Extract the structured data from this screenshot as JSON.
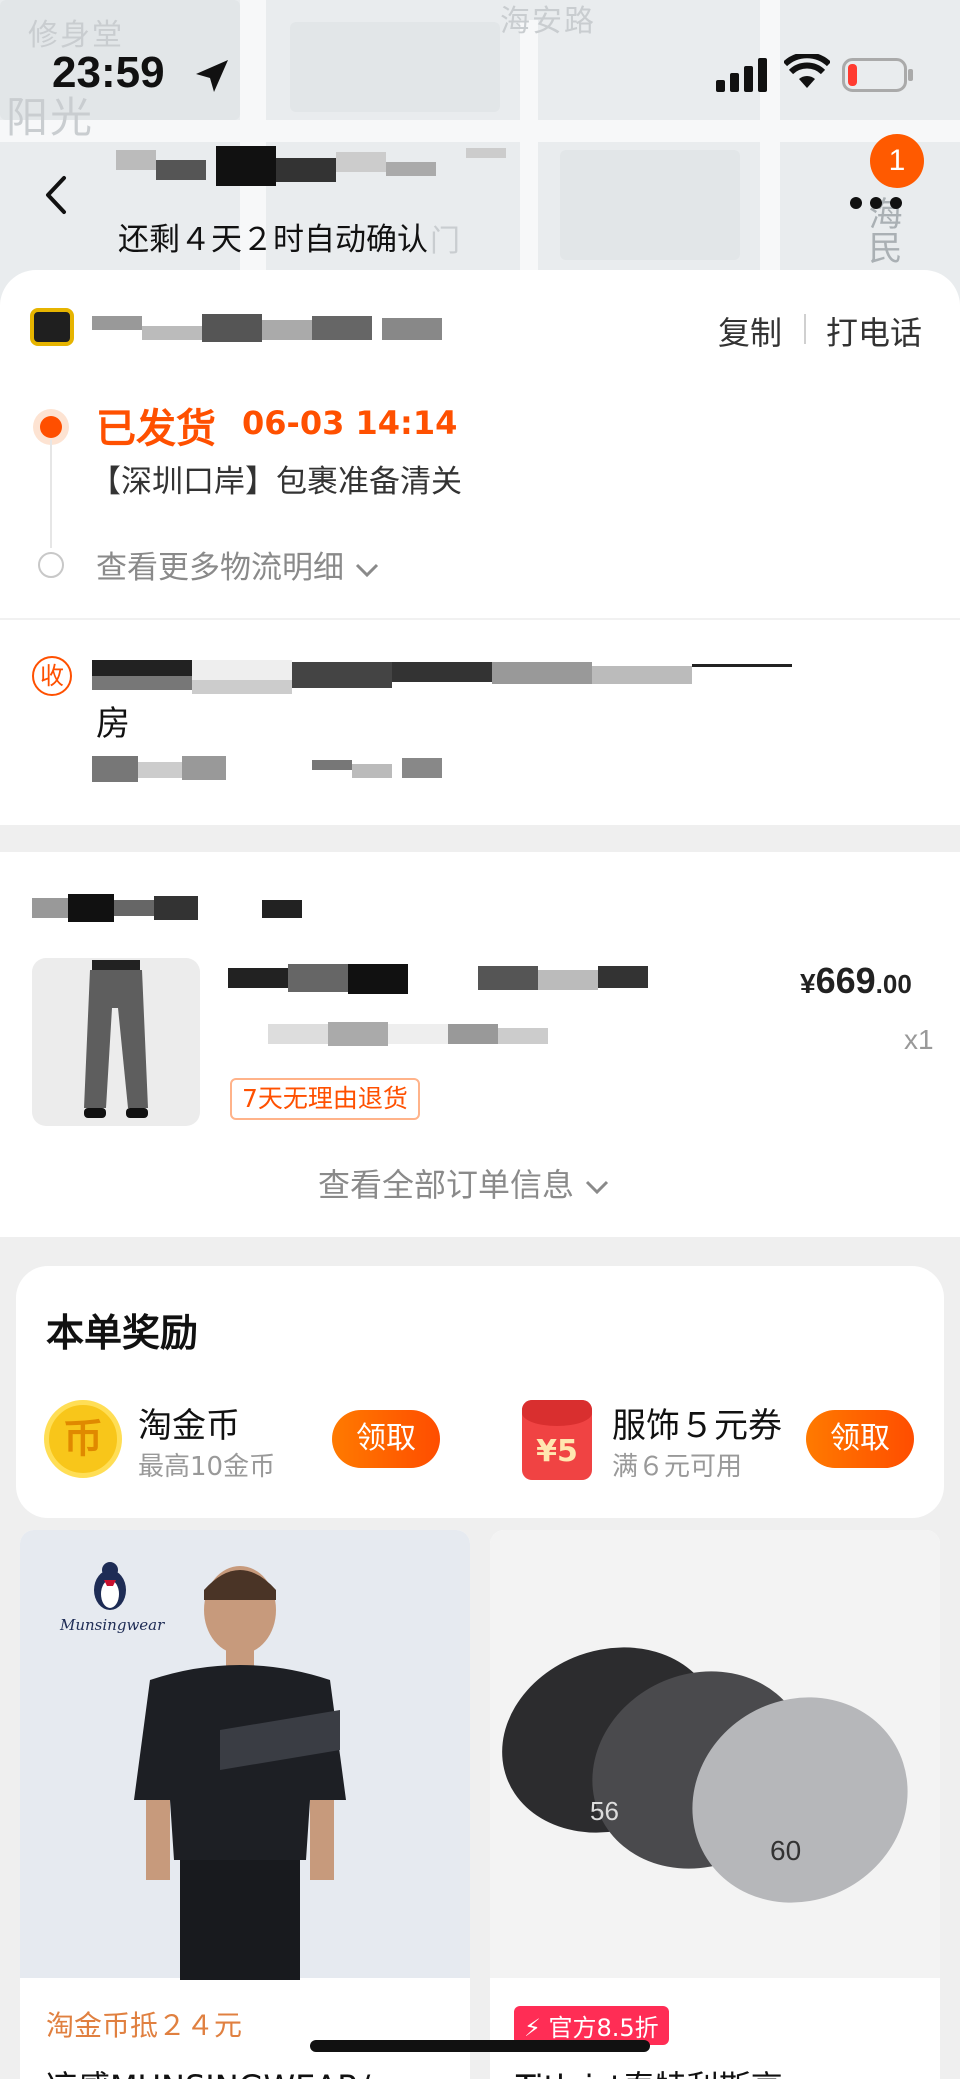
{
  "status_bar": {
    "time": "23:59"
  },
  "map": {
    "labels": [
      "修身堂",
      "阳光",
      "海安路",
      "门",
      "海民"
    ]
  },
  "header": {
    "auto_confirm": "还剩４天２时自动确认",
    "notification_count": "1"
  },
  "shop": {
    "copy_label": "复制",
    "call_label": "打电话"
  },
  "logistics": {
    "status": "已发货",
    "time": "06-03 14:14",
    "detail": "【深圳口岸】包裹准备清关",
    "more_label": "查看更多物流明细"
  },
  "receiver": {
    "icon_label": "收",
    "room": "房"
  },
  "order": {
    "price_currency": "¥",
    "price_int": "669",
    "price_dec": ".00",
    "quantity": "x1",
    "return_badge": "7天无理由退货",
    "view_all_label": "查看全部订单信息"
  },
  "rewards": {
    "title": "本单奖励",
    "coin": {
      "icon_glyph": "币",
      "title": "淘金币",
      "subtitle": "最高10金币",
      "button": "领取"
    },
    "coupon": {
      "icon_value": "¥5",
      "title": "服饰５元券",
      "subtitle": "满６元可用",
      "button": "领取"
    }
  },
  "recommendations": [
    {
      "brand": "Munsingwear",
      "tag": "淘金币抵２４元",
      "name": "凉感MUNSINGWEAR/"
    },
    {
      "tag": "官方8.5折",
      "name": "Titleist泰特利斯高"
    }
  ],
  "colors": {
    "accent": "#ff5000",
    "background": "#efefef"
  }
}
